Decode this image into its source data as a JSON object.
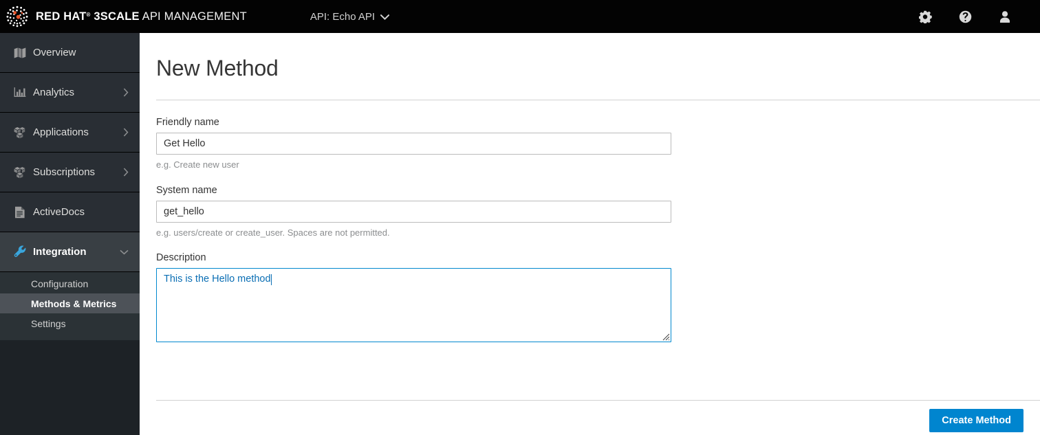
{
  "masthead": {
    "logo_icon": "redhat-logo-icon",
    "brand_primary": "RED HAT",
    "brand_registered": "®",
    "brand_secondary": "3SCALE",
    "brand_tail": "API MANAGEMENT",
    "api_switcher_label": "API: Echo API",
    "api_switcher_caret": "⌄",
    "tools": [
      {
        "name": "settings-icon",
        "label": "Settings"
      },
      {
        "name": "help-icon",
        "label": "Help"
      },
      {
        "name": "user-account-icon",
        "label": "Account"
      }
    ],
    "background_color": "#030303"
  },
  "sidebar": {
    "background_color": "#1d2226",
    "active_color": "#39a5dc",
    "items": [
      {
        "label": "Overview",
        "icon": "map-icon",
        "has_chevron": false,
        "chevron": "",
        "active": false
      },
      {
        "label": "Analytics",
        "icon": "bar-chart-icon",
        "has_chevron": true,
        "chevron": "›",
        "active": false
      },
      {
        "label": "Applications",
        "icon": "cubes-icon",
        "has_chevron": true,
        "chevron": "›",
        "active": false
      },
      {
        "label": "Subscriptions",
        "icon": "cubes-icon",
        "has_chevron": true,
        "chevron": "›",
        "active": false
      },
      {
        "label": "ActiveDocs",
        "icon": "document-icon",
        "has_chevron": false,
        "chevron": "",
        "active": false
      },
      {
        "label": "Integration",
        "icon": "wrench-icon",
        "has_chevron": true,
        "chevron": "⌄",
        "active": true
      }
    ],
    "submenu": [
      {
        "label": "Configuration",
        "active": false
      },
      {
        "label": "Methods & Metrics",
        "active": true
      },
      {
        "label": "Settings",
        "active": false
      }
    ]
  },
  "main": {
    "page_title": "New Method",
    "fields": [
      {
        "label": "Friendly name",
        "value": "Get Hello",
        "placeholder": "",
        "help": "e.g. Create new user"
      },
      {
        "label": "System name",
        "value": "get_hello",
        "placeholder": "",
        "help": "e.g. users/create or create_user. Spaces are not permitted."
      }
    ],
    "description": {
      "label": "Description",
      "value": "This is the Hello method",
      "placeholder": "",
      "focused": true,
      "focus_color": "#0088ce"
    },
    "submit_button": {
      "label": "Create Method",
      "color": "#0085cf"
    }
  }
}
